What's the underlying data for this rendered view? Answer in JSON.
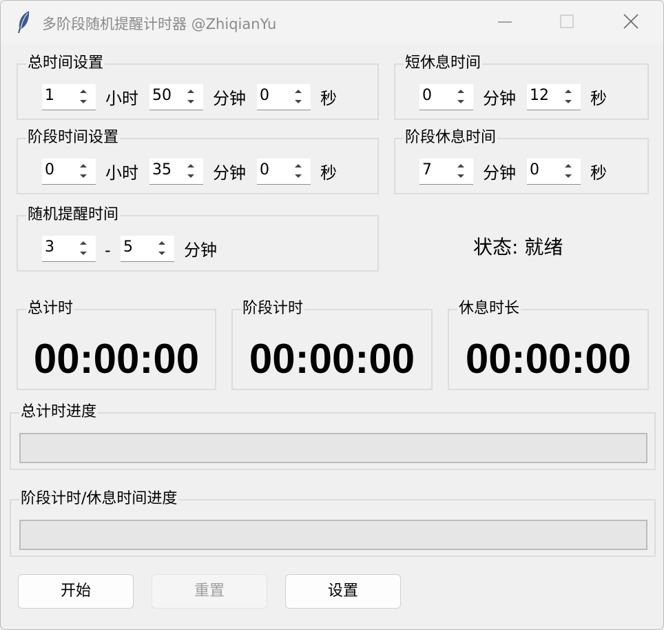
{
  "window": {
    "title": "多阶段随机提醒计时器 @ZhiqianYu",
    "icon": "feather-icon"
  },
  "total_time_settings": {
    "legend": "总时间设置",
    "hours": "1",
    "hours_unit": "小时",
    "minutes": "50",
    "minutes_unit": "分钟",
    "seconds": "0",
    "seconds_unit": "秒"
  },
  "short_rest_time": {
    "legend": "短休息时间",
    "minutes": "0",
    "minutes_unit": "分钟",
    "seconds": "12",
    "seconds_unit": "秒"
  },
  "stage_time_settings": {
    "legend": "阶段时间设置",
    "hours": "0",
    "hours_unit": "小时",
    "minutes": "35",
    "minutes_unit": "分钟",
    "seconds": "0",
    "seconds_unit": "秒"
  },
  "stage_rest_time": {
    "legend": "阶段休息时间",
    "minutes": "7",
    "minutes_unit": "分钟",
    "seconds": "0",
    "seconds_unit": "秒"
  },
  "random_reminder_time": {
    "legend": "随机提醒时间",
    "min": "3",
    "separator": "-",
    "max": "5",
    "unit": "分钟"
  },
  "status": {
    "text": "状态: 就绪"
  },
  "timers": {
    "total": {
      "label": "总计时",
      "value": "00:00:00"
    },
    "stage": {
      "label": "阶段计时",
      "value": "00:00:00"
    },
    "rest": {
      "label": "休息时长",
      "value": "00:00:00"
    }
  },
  "progress": {
    "total": {
      "label": "总计时进度",
      "value": 0
    },
    "stage": {
      "label": "阶段计时/休息时间进度",
      "value": 0
    }
  },
  "buttons": {
    "start": "开始",
    "reset": "重置",
    "settings": "设置"
  },
  "colors": {
    "progress_fill": "#06b025",
    "background": "#f0f0f0"
  }
}
